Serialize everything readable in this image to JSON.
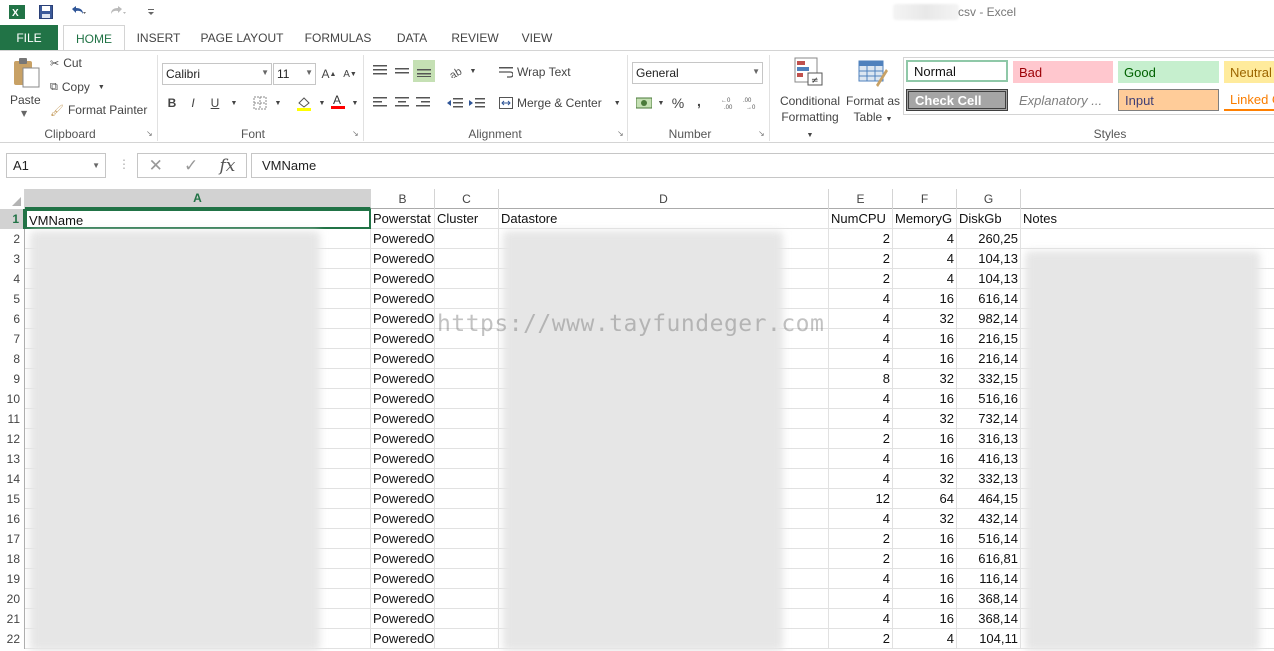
{
  "window": {
    "title": "csv - Excel"
  },
  "quick_access": {
    "save_icon": "save-icon",
    "undo_icon": "undo-icon",
    "redo_icon": "redo-icon",
    "customize_icon": "customize-icon"
  },
  "tabs": [
    "FILE",
    "HOME",
    "INSERT",
    "PAGE LAYOUT",
    "FORMULAS",
    "DATA",
    "REVIEW",
    "VIEW"
  ],
  "active_tab": "HOME",
  "ribbon": {
    "clipboard": {
      "paste": "Paste",
      "cut": "Cut",
      "copy": "Copy",
      "format_painter": "Format Painter",
      "label": "Clipboard"
    },
    "font": {
      "name": "Calibri",
      "size": "11",
      "bold": "B",
      "italic": "I",
      "underline": "U",
      "label": "Font"
    },
    "alignment": {
      "wrap_text": "Wrap Text",
      "merge_center": "Merge & Center",
      "label": "Alignment"
    },
    "number": {
      "format": "General",
      "percent": "%",
      "comma": ",",
      "label": "Number"
    },
    "styles": {
      "conditional_formatting": [
        "Conditional",
        "Formatting"
      ],
      "format_as_table": [
        "Format as",
        "Table"
      ],
      "normal": "Normal",
      "bad": "Bad",
      "good": "Good",
      "neutral": "Neutral",
      "check_cell": "Check Cell",
      "explanatory": "Explanatory ...",
      "input": "Input",
      "linked": "Linked C",
      "label": "Styles"
    }
  },
  "formula_bar": {
    "name_box": "A1",
    "content": "VMName"
  },
  "columns": [
    "A",
    "B",
    "C",
    "D",
    "E",
    "F",
    "G"
  ],
  "selected_column": "A",
  "header_row": {
    "A": "VMName",
    "B": "Powerstat",
    "C": "Cluster",
    "D": "Datastore",
    "E": "NumCPU",
    "F": "MemoryG",
    "G": "DiskGb",
    "H": "Notes"
  },
  "rows": [
    {
      "n": "2",
      "power": "PoweredOff",
      "cpu": "2",
      "mem": "4",
      "disk": "260,25"
    },
    {
      "n": "3",
      "power": "PoweredOn",
      "cpu": "2",
      "mem": "4",
      "disk": "104,13"
    },
    {
      "n": "4",
      "power": "PoweredOn",
      "cpu": "2",
      "mem": "4",
      "disk": "104,13"
    },
    {
      "n": "5",
      "power": "PoweredOn",
      "cpu": "4",
      "mem": "16",
      "disk": "616,14"
    },
    {
      "n": "6",
      "power": "PoweredOn",
      "cpu": "4",
      "mem": "32",
      "disk": "982,14"
    },
    {
      "n": "7",
      "power": "PoweredOn",
      "cpu": "4",
      "mem": "16",
      "disk": "216,15"
    },
    {
      "n": "8",
      "power": "PoweredOn",
      "cpu": "4",
      "mem": "16",
      "disk": "216,14"
    },
    {
      "n": "9",
      "power": "PoweredOn",
      "cpu": "8",
      "mem": "32",
      "disk": "332,15"
    },
    {
      "n": "10",
      "power": "PoweredOn",
      "cpu": "4",
      "mem": "16",
      "disk": "516,16"
    },
    {
      "n": "11",
      "power": "PoweredOn",
      "cpu": "4",
      "mem": "32",
      "disk": "732,14"
    },
    {
      "n": "12",
      "power": "PoweredOn",
      "cpu": "2",
      "mem": "16",
      "disk": "316,13"
    },
    {
      "n": "13",
      "power": "PoweredOn",
      "cpu": "4",
      "mem": "16",
      "disk": "416,13"
    },
    {
      "n": "14",
      "power": "PoweredOn",
      "cpu": "4",
      "mem": "32",
      "disk": "332,13"
    },
    {
      "n": "15",
      "power": "PoweredOn",
      "cpu": "12",
      "mem": "64",
      "disk": "464,15"
    },
    {
      "n": "16",
      "power": "PoweredOn",
      "cpu": "4",
      "mem": "32",
      "disk": "432,14"
    },
    {
      "n": "17",
      "power": "PoweredOn",
      "cpu": "2",
      "mem": "16",
      "disk": "516,14"
    },
    {
      "n": "18",
      "power": "PoweredOn",
      "cpu": "2",
      "mem": "16",
      "disk": "616,81"
    },
    {
      "n": "19",
      "power": "PoweredOn",
      "cpu": "4",
      "mem": "16",
      "disk": "116,14"
    },
    {
      "n": "20",
      "power": "PoweredOn",
      "cpu": "4",
      "mem": "16",
      "disk": "368,14"
    },
    {
      "n": "21",
      "power": "PoweredOn",
      "cpu": "4",
      "mem": "16",
      "disk": "368,14"
    },
    {
      "n": "22",
      "power": "PoweredOn",
      "cpu": "2",
      "mem": "4",
      "disk": "104,11"
    }
  ],
  "watermark": "https://www.tayfundeger.com",
  "colors": {
    "excel_green": "#217346",
    "bad_fill": "#ffc7ce",
    "good_fill": "#c6efce",
    "neutral_fill": "#ffeb9c",
    "input_fill": "#ffcc99",
    "check_fill": "#a5a5a5"
  }
}
